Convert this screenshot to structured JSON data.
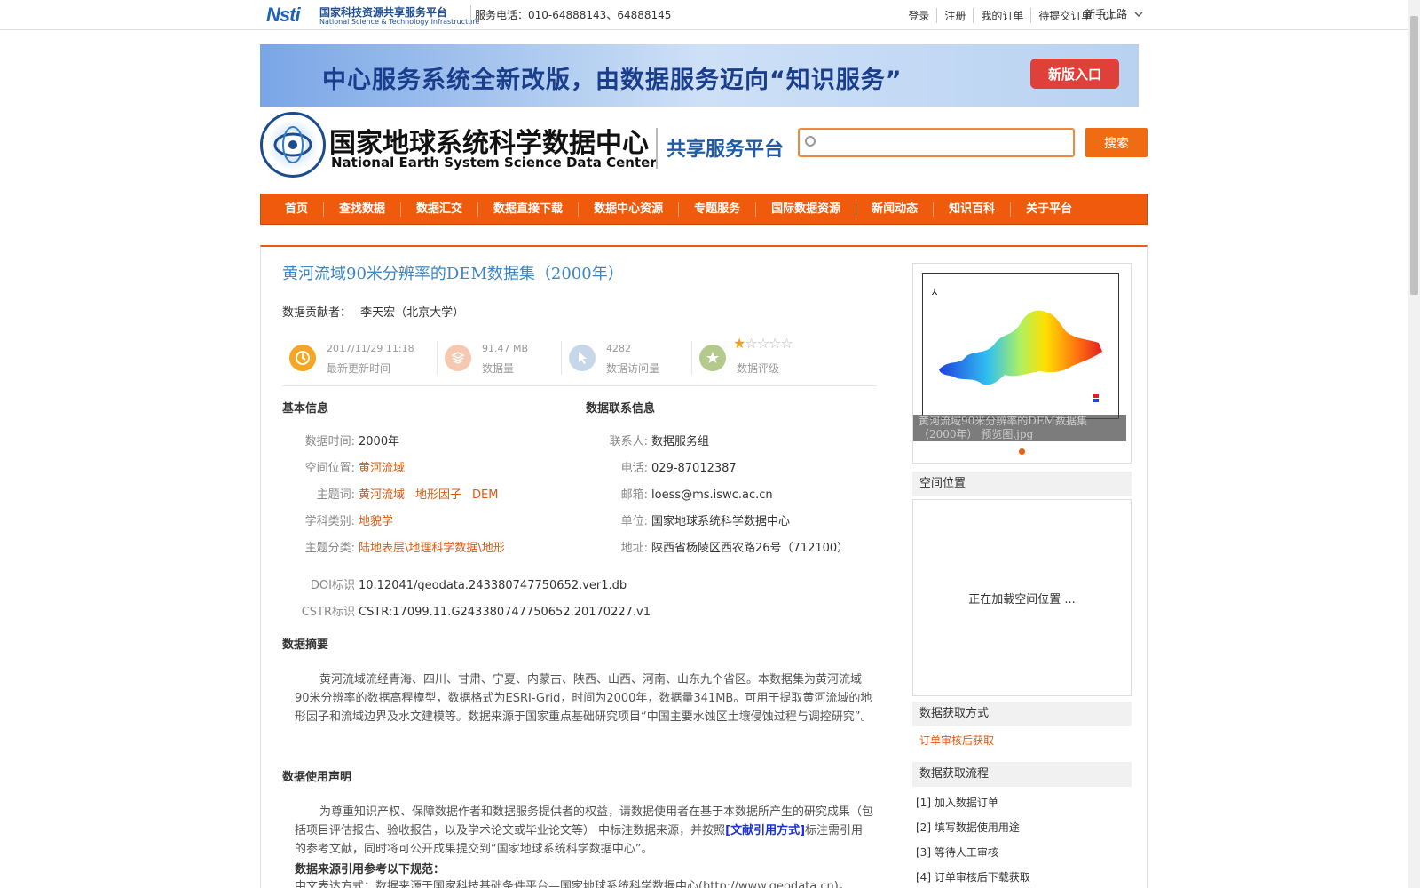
{
  "topbar": {
    "nsti_logo_text": "Nsti",
    "nsti_cn": "国家科技资源共享服务平台",
    "nsti_en": "National Science & Technology Infrastructure",
    "phone": "服务电话：010-64888143、64888145",
    "links": [
      "登录",
      "注册",
      "我的订单",
      "待提交订单（0）"
    ],
    "newbie": "新手上路"
  },
  "banner": {
    "text": "中心服务系统全新改版，由数据服务迈向“知识服务”",
    "button": "新版入口"
  },
  "header": {
    "center_cn": "国家地球系统科学数据中心",
    "center_en": "National Earth System Science Data Center",
    "platform": "共享服务平台",
    "search_placeholder": "",
    "search_button": "搜索"
  },
  "nav": [
    "首页",
    "查找数据",
    "数据汇交",
    "数据直接下载",
    "数据中心资源",
    "专题服务",
    "国际数据资源",
    "新闻动态",
    "知识百科",
    "关于平台"
  ],
  "dataset": {
    "title": "黄河流域90米分辨率的DEM数据集（2000年）",
    "contributor_label": "数据贡献者：",
    "contributor": "李天宏（北京大学）",
    "stats": [
      {
        "value": "2017/11/29 11:18",
        "label": "最新更新时间",
        "icon": "clock-icon",
        "color": "#f5a623"
      },
      {
        "value": "91.47 MB",
        "label": "数据量",
        "icon": "layers-icon",
        "color": "#f7c8b0"
      },
      {
        "value": "4282",
        "label": "数据访问量",
        "icon": "cursor-icon",
        "color": "#c7d7ea"
      },
      {
        "value": "",
        "label": "数据评级",
        "icon": "star-badge-icon",
        "color": "#b4c98c"
      }
    ],
    "rating": 1,
    "rating_max": 5
  },
  "basic_info": {
    "heading": "基本信息",
    "data_time_label": "数据时间:",
    "data_time": "2000年",
    "location_label": "空间位置:",
    "location": "黄河流域",
    "keywords_label": "主题词:",
    "keywords": [
      "黄河流域",
      "地形因子",
      "DEM"
    ],
    "discipline_label": "学科类别:",
    "discipline": "地貌学",
    "category_label": "主题分类:",
    "category": "陆地表层\\地理科学数据\\地形",
    "doi_label": "DOI标识",
    "doi": "10.12041/geodata.243380747750652.ver1.db",
    "cstr_label": "CSTR标识",
    "cstr": "CSTR:17099.11.G243380747750652.20170227.v1"
  },
  "contact_info": {
    "heading": "数据联系信息",
    "contact_label": "联系人:",
    "contact": "数据服务组",
    "phone_label": "电话:",
    "phone": "029-87012387",
    "email_label": "邮箱:",
    "email": "loess@ms.iswc.ac.cn",
    "org_label": "单位:",
    "org": "国家地球系统科学数据中心",
    "address_label": "地址:",
    "address": "陕西省杨陵区西农路26号（712100）"
  },
  "abstract": {
    "heading": "数据摘要",
    "text": "黄河流域流经青海、四川、甘肃、宁夏、内蒙古、陕西、山西、河南、山东九个省区。本数据集为黄河流域90米分辨率的数据高程模型，数据格式为ESRI-Grid，时间为2000年，数据量341MB。可用于提取黄河流域的地形因子和流域边界及水文建模等。数据来源于国家重点基础研究项目“中国主要水蚀区土壤侵蚀过程与调控研究”。"
  },
  "usage": {
    "heading": "数据使用声明",
    "text_before": "为尊重知识产权、保障数据作者和数据服务提供者的权益，请数据使用者在基于本数据所产生的研究成果（包括项目评估报告、验收报告，以及学术论文或毕业论文等） 中标注数据来源，并按照",
    "link": "[文献引用方式]",
    "text_after": "标注需引用的参考文献，同时将可公开成果提交到“国家地球系统科学数据中心”。",
    "ref_heading": "数据来源引用参考以下规范：",
    "ref_text": "中文表达方式：数据来源于国家科技基础条件平台—国家地球系统科学数据中心(http://www.geodata.cn)。"
  },
  "sidebar": {
    "thumb_caption": "黄河流域90米分辨率的DEM数据集（2000年） 预览图.jpg",
    "spatial_heading": "空间位置",
    "loading": "正在加载空间位置 ...",
    "access_heading": "数据获取方式",
    "access_value": "订单审核后获取",
    "flow_heading": "数据获取流程",
    "flow_steps": [
      "[1] 加入数据订单",
      "[2] 填写数据使用用途",
      "[3] 等待人工审核",
      "[4] 订单审核后下载获取"
    ]
  }
}
